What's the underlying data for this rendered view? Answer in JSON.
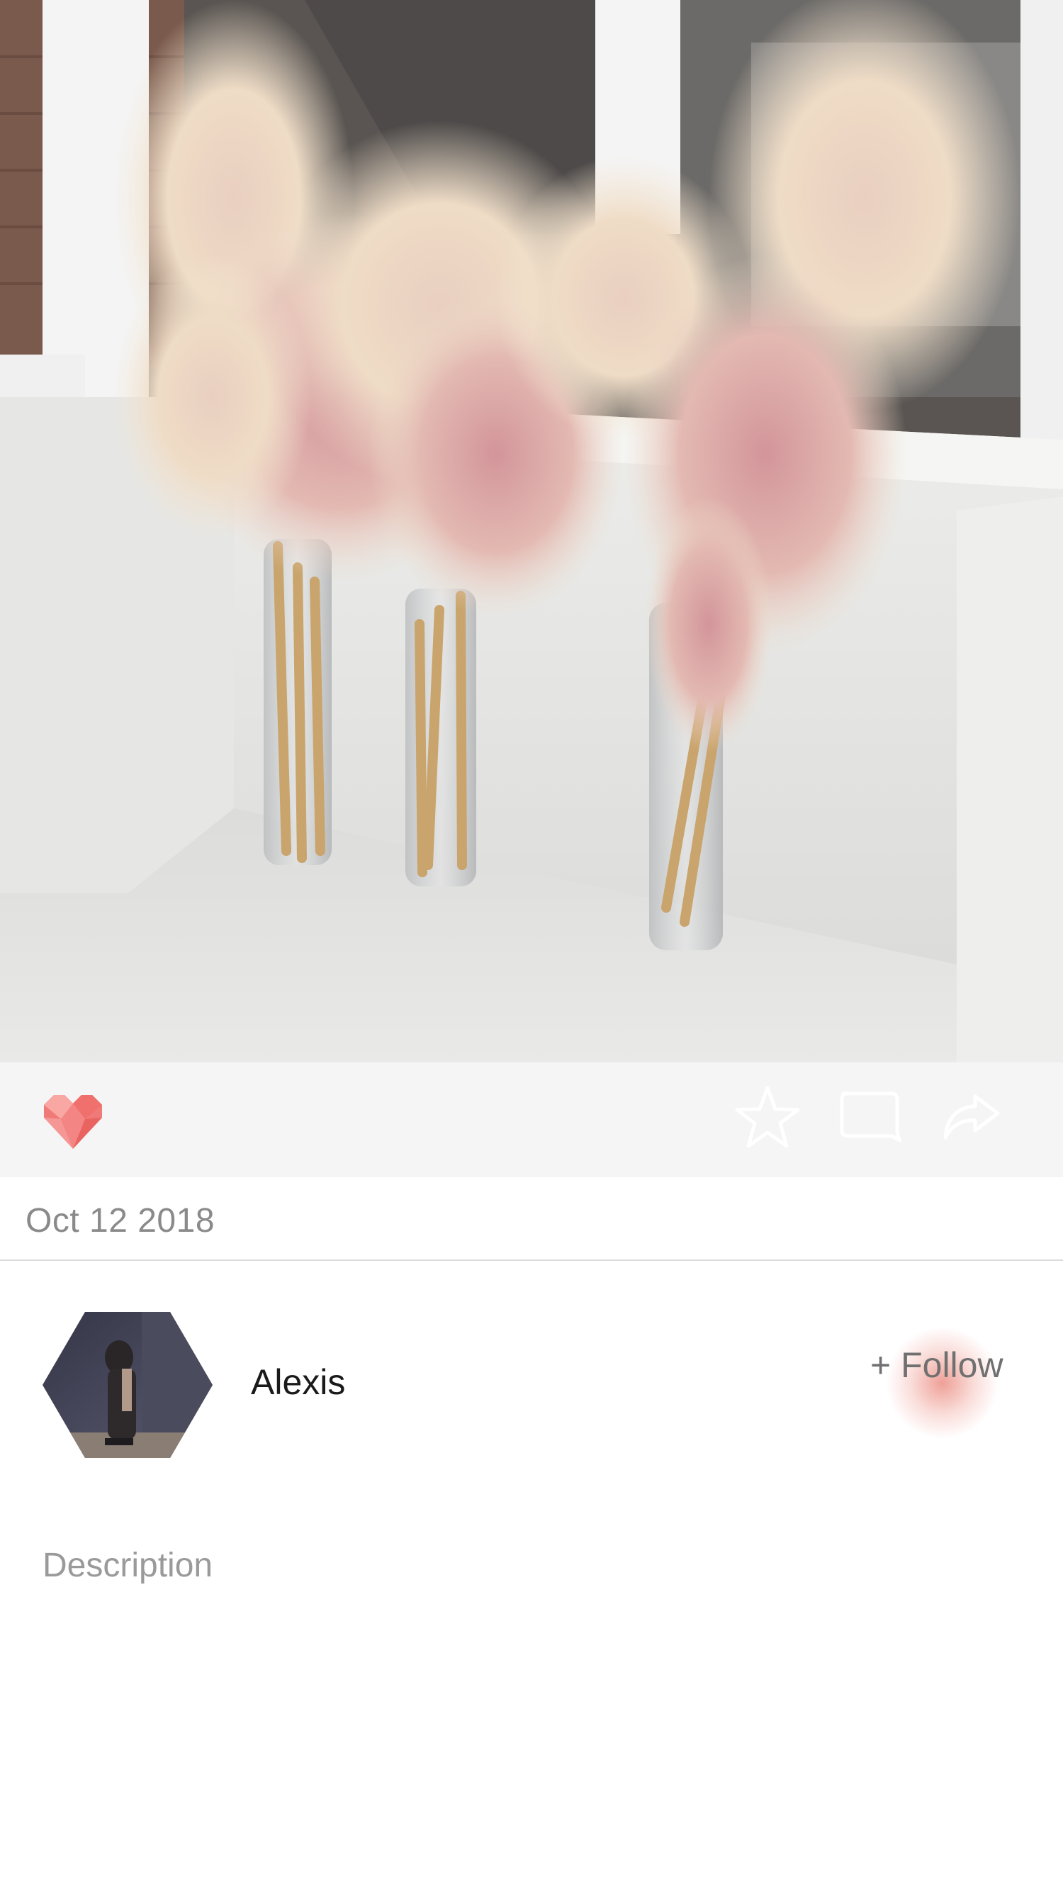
{
  "post": {
    "photo_icon": "pampas-grass-photo",
    "date": "Oct 12 2018"
  },
  "actions": {
    "like_icon": "heart-icon",
    "favorite_icon": "star-icon",
    "comment_icon": "comment-icon",
    "share_icon": "share-icon",
    "like_color": "#f07a78"
  },
  "user": {
    "name": "Alexis",
    "follow_label": "+ Follow"
  },
  "description": {
    "placeholder": "Description"
  },
  "colors": {
    "action_bar_bg": "#f5f5f5",
    "accent": "#e87c70"
  }
}
